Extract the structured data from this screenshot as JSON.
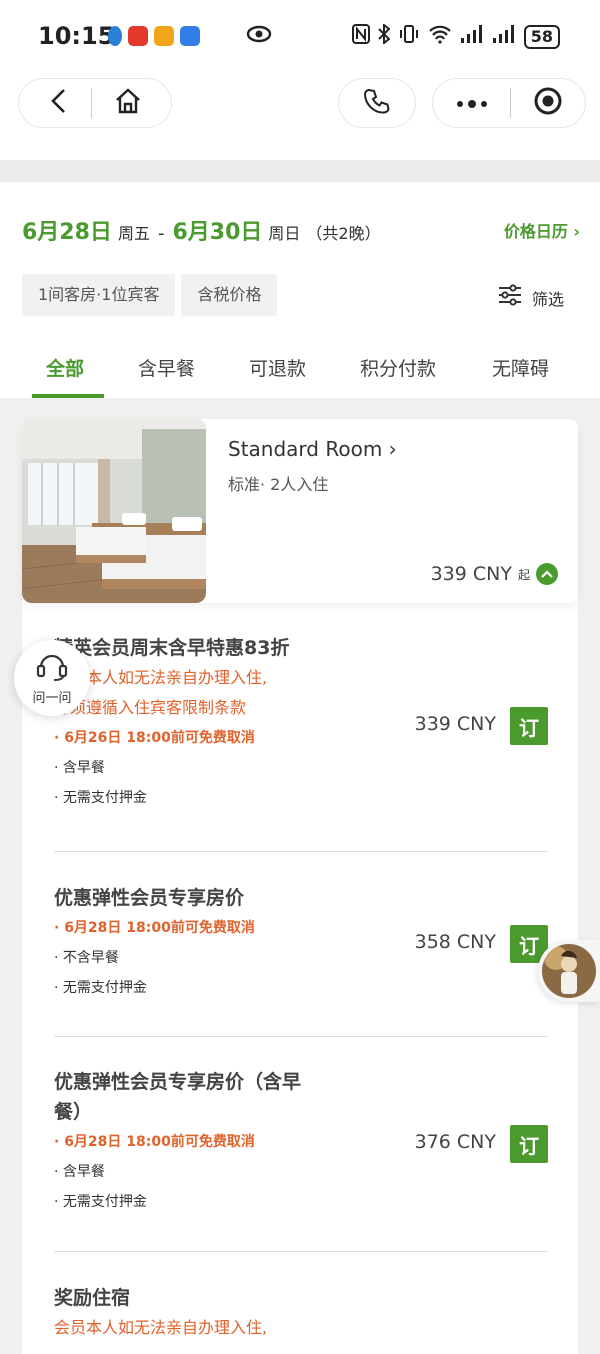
{
  "status_bar": {
    "time": "10:15",
    "battery": "58",
    "icons": [
      "app-notification-icon",
      "eye-icon",
      "nfc-icon",
      "bluetooth-icon",
      "vibrate-icon",
      "wifi-icon",
      "signal-icon",
      "signal-icon"
    ]
  },
  "nav": {
    "back_icon": "chevron-left-icon",
    "home_icon": "home-icon",
    "phone_icon": "phone-icon",
    "more_icon": "more-dots-icon",
    "target_icon": "target-icon"
  },
  "dates": {
    "checkin": "6月28日",
    "checkin_week": "周五",
    "sep": "-",
    "checkout": "6月30日",
    "checkout_week": "周日",
    "nights": "（共2晚）",
    "price_calendar": "价格日历 ›"
  },
  "chips": {
    "rooms_guests": "1间客房·1位宾客",
    "tax_price": "含税价格"
  },
  "filter": {
    "label": "筛选"
  },
  "tabs": [
    "全部",
    "含早餐",
    "可退款",
    "积分付款",
    "无障碍"
  ],
  "room": {
    "name": "Standard Room ›",
    "sub": "标准· 2人入住",
    "price": "339 CNY",
    "price_suffix": "起"
  },
  "rates": [
    {
      "title": "精英会员周末含早特惠83折",
      "warn1": "会员本人如无法亲自办理入住,",
      "warn2": "必须遵循入住宾客限制条款",
      "cancel": "· 6月26日 18:00前可免费取消",
      "line1": "· 含早餐",
      "line2": "· 无需支付押金",
      "price": "339 CNY",
      "book": "订"
    },
    {
      "title": "优惠弹性会员专享房价",
      "cancel": "· 6月28日 18:00前可免费取消",
      "line1": "· 不含早餐",
      "line2": "· 无需支付押金",
      "price": "358 CNY",
      "book": "订"
    },
    {
      "title1": "优惠弹性会员专享房价（含早",
      "title2": "餐）",
      "cancel": "· 6月28日 18:00前可免费取消",
      "line1": "· 含早餐",
      "line2": "· 无需支付押金",
      "price": "376 CNY",
      "book": "订"
    },
    {
      "title": "奖励住宿",
      "warn1": "会员本人如无法亲自办理入住,"
    }
  ],
  "ask": {
    "label": "问一问"
  },
  "colors": {
    "brand_green": "#4a9a2e",
    "warn_orange": "#e2622c"
  }
}
